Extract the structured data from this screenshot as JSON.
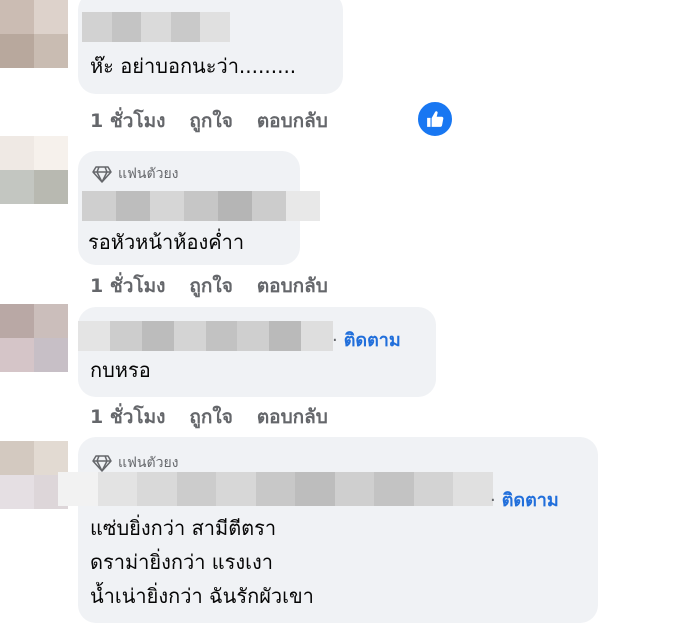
{
  "comments": [
    {
      "text_lines": [
        "ห๊ะ อย่าบอกนะว่า........."
      ],
      "badge": null,
      "follow": null,
      "time": "1 ชั่วโมง",
      "like": "ถูกใจ",
      "reply": "ตอบกลับ",
      "has_like_reaction": true
    },
    {
      "text_lines": [
        "รอหัวหน้าห้องค่ำา"
      ],
      "badge": "แฟนตัวยง",
      "follow": null,
      "time": "1 ชั่วโมง",
      "like": "ถูกใจ",
      "reply": "ตอบกลับ",
      "has_like_reaction": false
    },
    {
      "text_lines": [
        "กบหรอ"
      ],
      "badge": null,
      "follow": "ติดตาม",
      "time": "1 ชั่วโมง",
      "like": "ถูกใจ",
      "reply": "ตอบกลับ",
      "has_like_reaction": false
    },
    {
      "text_lines": [
        "แซ่บยิ่งกว่า สามีตีตรา",
        "ดราม่ายิ่งกว่า แรงเงา",
        "น้ำเน่ายิ่งกว่า ฉันรักผัวเขา"
      ],
      "badge": "แฟนตัวยง",
      "follow": "ติดตาม",
      "time": null,
      "like": null,
      "reply": null,
      "has_like_reaction": false
    }
  ],
  "icons": {
    "badge_icon": "diamond-icon",
    "reaction_icon": "thumbs-up-icon"
  },
  "colors": {
    "bubble_bg": "#f0f2f5",
    "link_blue": "#216fdb",
    "meta_gray": "#65676b",
    "like_blue": "#1877f2"
  }
}
